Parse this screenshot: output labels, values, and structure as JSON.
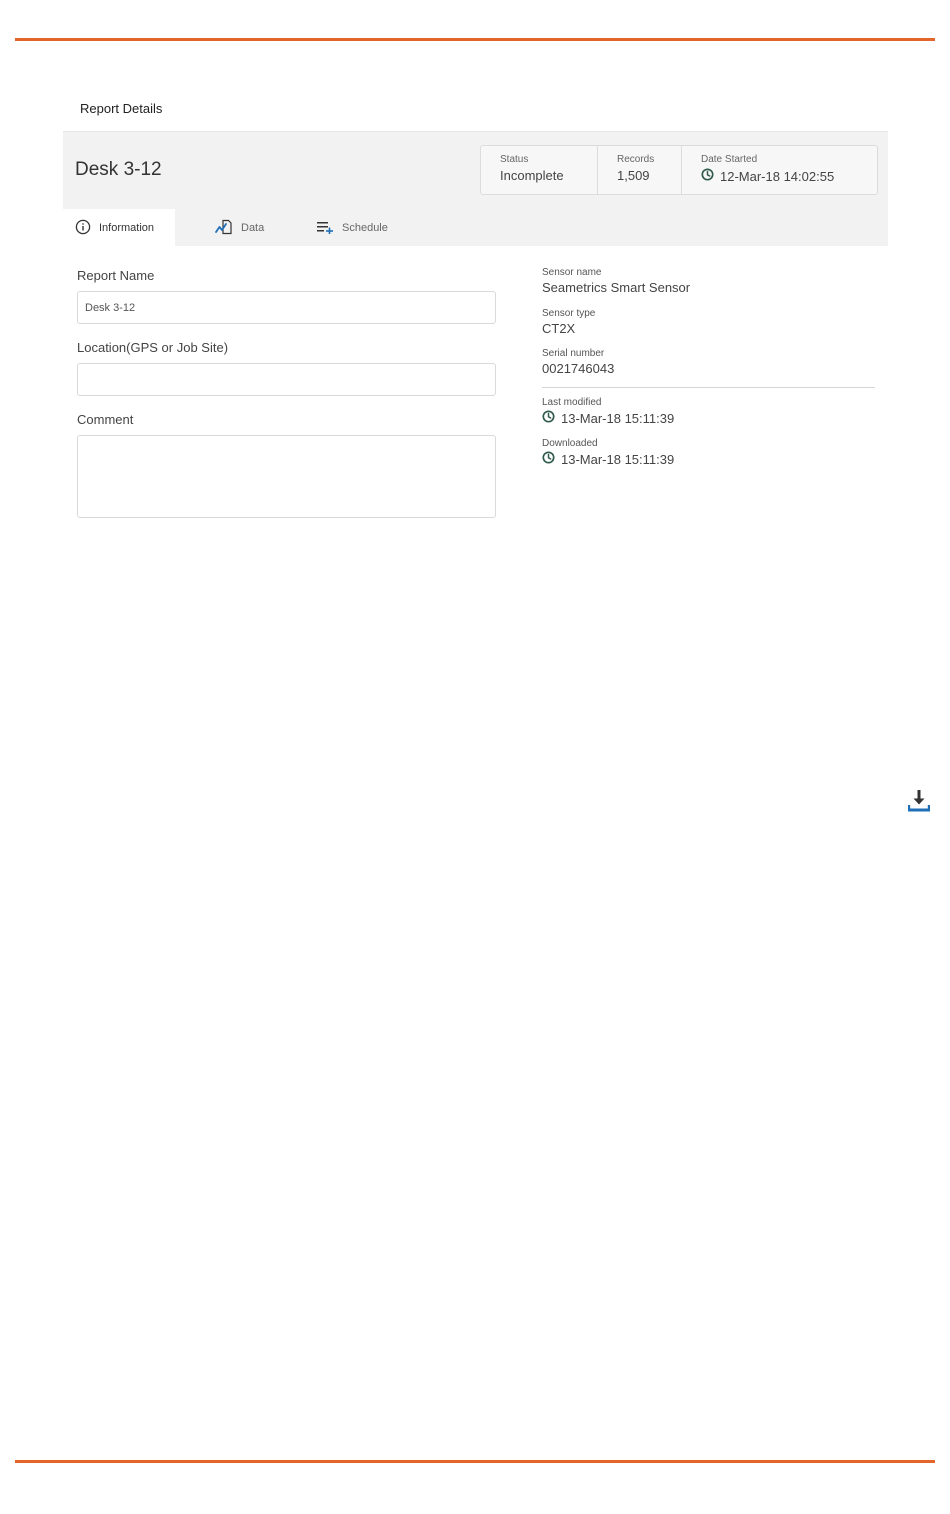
{
  "colors": {
    "accent_rule": "#e2662a",
    "icon_dark": "#2f5a4d",
    "icon_blue": "#1f6fb8"
  },
  "page": {
    "heading": "Report Details"
  },
  "report": {
    "title": "Desk 3-12",
    "stats": {
      "status_label": "Status",
      "status_value": "Incomplete",
      "records_label": "Records",
      "records_value": "1,509",
      "date_started_label": "Date Started",
      "date_started_value": "12-Mar-18 14:02:55"
    }
  },
  "tabs": [
    {
      "label": "Information",
      "icon": "info-icon",
      "active": true
    },
    {
      "label": "Data",
      "icon": "chart-data-icon",
      "active": false
    },
    {
      "label": "Schedule",
      "icon": "playlist-add-icon",
      "active": false
    }
  ],
  "form": {
    "report_name_label": "Report Name",
    "report_name_value": "Desk 3-12",
    "location_label": "Location(GPS or Job Site)",
    "location_value": "",
    "comment_label": "Comment",
    "comment_value": ""
  },
  "sensor": {
    "name_label": "Sensor name",
    "name_value": "Seametrics Smart Sensor",
    "type_label": "Sensor type",
    "type_value": "CT2X",
    "serial_label": "Serial number",
    "serial_value": "0021746043",
    "last_modified_label": "Last modified",
    "last_modified_value": "13-Mar-18 15:11:39",
    "downloaded_label": "Downloaded",
    "downloaded_value": "13-Mar-18 15:11:39"
  },
  "actions": {
    "download_icon": "download-icon"
  }
}
